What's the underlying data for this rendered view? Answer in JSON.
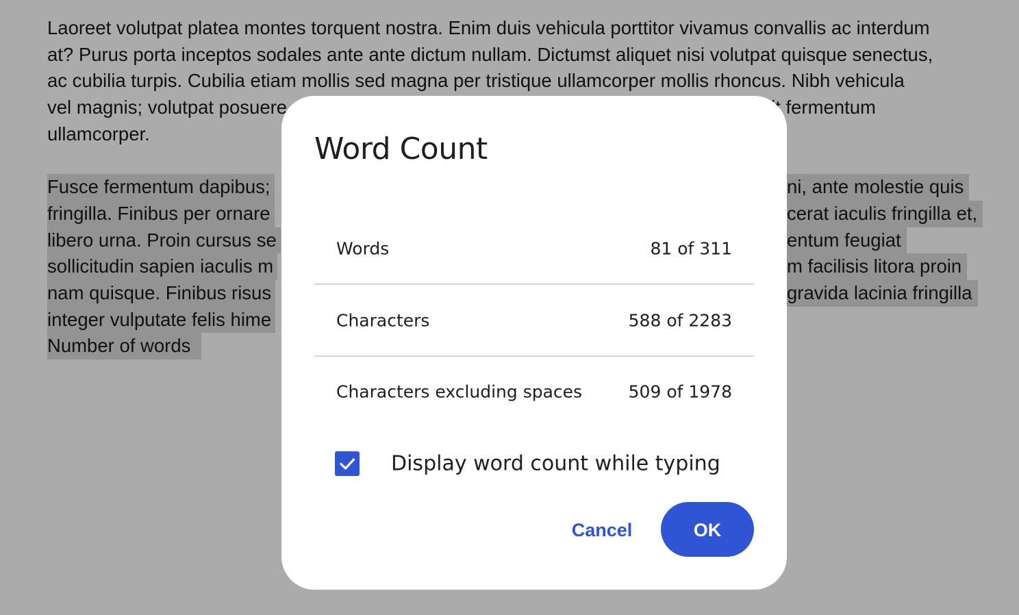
{
  "document": {
    "paragraph1": [
      "Laoreet volutpat platea montes torquent nostra. Enim duis vehicula porttitor vivamus convallis ac interdum",
      "at? Purus porta inceptos sodales ante ante dictum nullam. Dictumst aliquet nisi volutpat quisque senectus,",
      "ac cubilia turpis. Cubilia etiam mollis sed magna per tristique ullamcorper mollis rhoncus. Nibh vehicula",
      "vel magnis; volutpat posuere",
      "ullamcorper."
    ],
    "paragraph1_line4_tail": "lit fermentum",
    "paragraph2_left": [
      "Fusce fermentum dapibus;",
      "fringilla. Finibus per ornare",
      "libero urna. Proin cursus se",
      "sollicitudin sapien iaculis m",
      "nam quisque. Finibus risus",
      "integer vulputate felis hime",
      "Number of words"
    ],
    "paragraph2_right": [
      "ni, ante molestie quis",
      "cerat iaculis fringilla et,",
      "entum feugiat",
      "m facilisis litora proin",
      "gravida lacinia fringilla"
    ]
  },
  "dialog": {
    "title": "Word Count",
    "stats": [
      {
        "label": "Words",
        "value": "81 of 311"
      },
      {
        "label": "Characters",
        "value": "588 of 2283"
      },
      {
        "label": "Characters excluding spaces",
        "value": "509 of 1978"
      }
    ],
    "checkbox": {
      "label": "Display word count while typing",
      "checked": true
    },
    "cancel_label": "Cancel",
    "ok_label": "OK"
  },
  "colors": {
    "accent": "#2f54d4",
    "overlay": "#ababab",
    "selection": "#939393"
  }
}
